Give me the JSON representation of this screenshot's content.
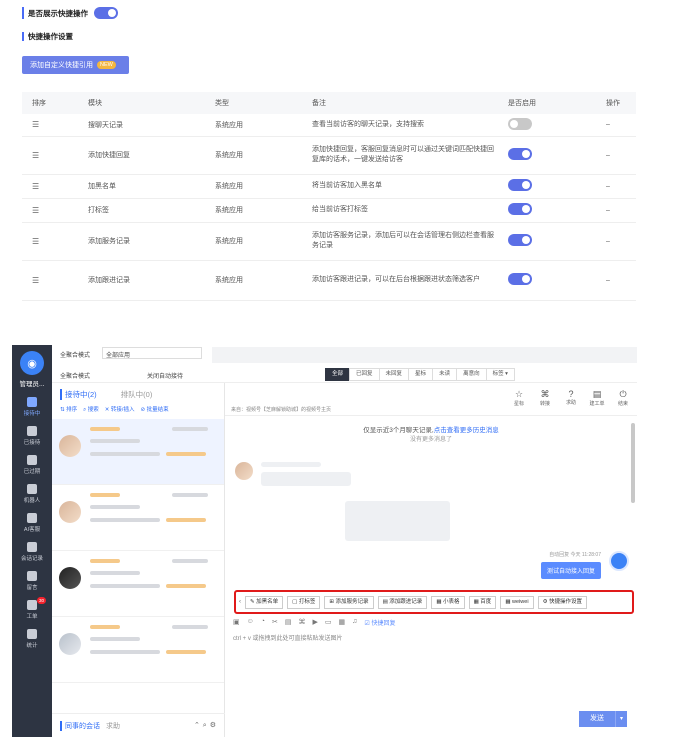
{
  "settings": {
    "show_quick_ops_label": "是否展示快捷操作",
    "show_quick_ops_enabled": true,
    "section_title": "快捷操作设置",
    "add_button_label": "添加自定义快捷引用",
    "add_button_badge": "NEW"
  },
  "table": {
    "headers": [
      "排序",
      "模块",
      "类型",
      "备注",
      "是否启用",
      "操作"
    ],
    "rows": [
      {
        "module": "搜聊天记录",
        "type": "系统应用",
        "remark": "查看当前访客的聊天记录，支持搜索",
        "enabled": false,
        "action": "–"
      },
      {
        "module": "添加快捷回复",
        "type": "系统应用",
        "remark": "添加快捷回复，客服回复消息时可以通过关键词匹配快捷回复库的话术，一键发送给访客",
        "enabled": true,
        "action": "–"
      },
      {
        "module": "加黑名单",
        "type": "系统应用",
        "remark": "将当前访客加入黑名单",
        "enabled": true,
        "action": "–"
      },
      {
        "module": "打标签",
        "type": "系统应用",
        "remark": "给当前访客打标签",
        "enabled": true,
        "action": "–"
      },
      {
        "module": "添加服务记录",
        "type": "系统应用",
        "remark": "添加访客服务记录，添加后可以在会话管理右侧边栏查看服务记录",
        "enabled": true,
        "action": "–"
      },
      {
        "module": "添加跟进记录",
        "type": "系统应用",
        "remark": "添加访客跟进记录，可以在后台根据跟进状态筛选客户",
        "enabled": true,
        "action": "–"
      }
    ]
  },
  "app": {
    "admin_label": "管理员...",
    "rail": [
      {
        "label": "接待中",
        "icon": "chat-bubble-icon",
        "active": true
      },
      {
        "label": "已接待",
        "icon": "check-chat-icon"
      },
      {
        "label": "已过期",
        "icon": "clock-chat-icon"
      },
      {
        "label": "机器人",
        "icon": "robot-icon"
      },
      {
        "label": "AI客服",
        "icon": "ai-bubble-icon"
      },
      {
        "label": "会话记录",
        "icon": "record-icon"
      },
      {
        "label": "留言",
        "icon": "note-icon"
      },
      {
        "label": "工单",
        "icon": "ticket-icon",
        "badge": "30"
      },
      {
        "label": "统计",
        "icon": "stats-icon"
      }
    ],
    "top": {
      "mode1_label": "全聚合模式",
      "mode1_value": "全部应用",
      "mode2_label": "全聚合模式",
      "mode3_label": "关闭自动接待"
    },
    "filters": [
      "全部",
      "已回复",
      "未回复",
      "星标",
      "未读",
      "离意向",
      "标签 ▾"
    ],
    "list": {
      "tab_active": "接待中(2)",
      "tab_inactive": "排队中(0)",
      "tools": [
        "排序",
        "搜索",
        "转接/插入",
        "批量结束"
      ],
      "footer_active": "同事的会话",
      "footer_inactive": "求助"
    },
    "chat": {
      "source": "来自：视频号【芝麻解锁助城】的视频号主页",
      "head_icons": [
        {
          "icon": "star-icon",
          "label": "星标"
        },
        {
          "icon": "transfer-icon",
          "label": "转接"
        },
        {
          "icon": "help-icon",
          "label": "求助"
        },
        {
          "icon": "ticket-create-icon",
          "label": "建工单"
        },
        {
          "icon": "power-icon",
          "label": "结束"
        }
      ],
      "notice_prefix": "仅显示近3个月聊天记录,",
      "notice_link": "点击查看更多历史消息",
      "no_more": "没有更多消息了",
      "autoreply_meta": "自动回复  今天 11:28:07",
      "autoreply_text": "测试自动接入回复",
      "quick_buttons": [
        "加黑名单",
        "打标签",
        "添加服务记录",
        "添加跟进记录",
        "小表格",
        "百度",
        "weiwei",
        "快捷操作设置"
      ],
      "composer_tip": "ctrl + v 或拖拽到此处可直接粘贴发送图片",
      "quick_reply_tag": "快捷回复",
      "send_label": "发送"
    }
  }
}
